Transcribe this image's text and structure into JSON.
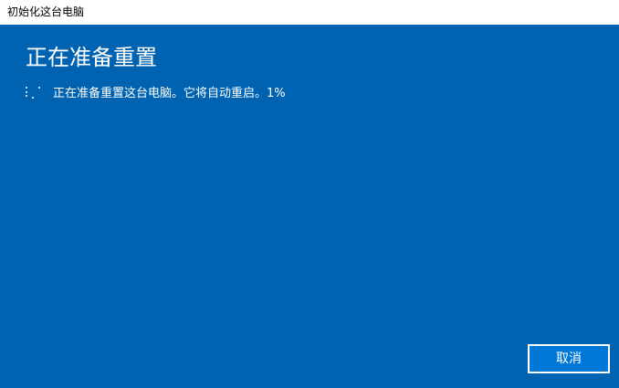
{
  "window": {
    "title": "初始化这台电脑"
  },
  "main": {
    "heading": "正在准备重置",
    "status_text": "正在准备重置这台电脑。它将自动重启。1%",
    "progress_percent": 1
  },
  "buttons": {
    "cancel_label": "取消"
  },
  "icons": {
    "spinner": "loading-spinner-icon"
  },
  "colors": {
    "background": "#0063b1",
    "titlebar": "#ffffff",
    "text": "#ffffff",
    "button_fill": "#0078d7",
    "button_border": "#ffffff"
  }
}
